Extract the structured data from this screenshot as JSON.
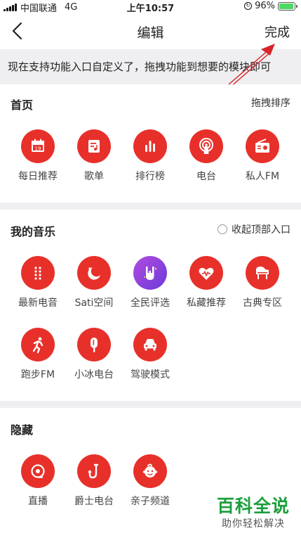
{
  "status_bar": {
    "carrier": "中国联通",
    "network": "4G",
    "time": "上午10:57",
    "battery": "96%",
    "battery_level": 0.96
  },
  "nav": {
    "title": "编辑",
    "done_label": "完成"
  },
  "tip": "现在支持功能入口自定义了，拖拽功能到想要的模块即可",
  "home": {
    "title": "首页",
    "action": "拖拽排序",
    "items": [
      {
        "label": "每日推荐",
        "icon": "calendar-icon"
      },
      {
        "label": "歌单",
        "icon": "playlist-icon"
      },
      {
        "label": "排行榜",
        "icon": "chart-bars-icon"
      },
      {
        "label": "电台",
        "icon": "radio-broadcast-icon"
      },
      {
        "label": "私人FM",
        "icon": "radio-fm-icon"
      }
    ]
  },
  "my_music": {
    "title": "我的音乐",
    "action": "收起顶部入口",
    "items": [
      {
        "label": "最新电音",
        "icon": "dots-grid-icon"
      },
      {
        "label": "Sati空间",
        "icon": "moon-star-icon"
      },
      {
        "label": "全民评选",
        "icon": "rock-hand-icon"
      },
      {
        "label": "私藏推荐",
        "icon": "heart-wave-icon"
      },
      {
        "label": "古典专区",
        "icon": "piano-icon"
      },
      {
        "label": "跑步FM",
        "icon": "running-icon"
      },
      {
        "label": "小冰电台",
        "icon": "popsicle-icon"
      },
      {
        "label": "驾驶模式",
        "icon": "car-icon"
      }
    ]
  },
  "hidden": {
    "title": "隐藏",
    "items": [
      {
        "label": "直播",
        "icon": "live-icon"
      },
      {
        "label": "爵士电台",
        "icon": "saxophone-icon"
      },
      {
        "label": "亲子频道",
        "icon": "baby-face-icon"
      }
    ]
  },
  "watermark": {
    "main": "百科全说",
    "sub": "助你轻松解决"
  },
  "colors": {
    "accent": "#e8302a",
    "background": "#efeff1",
    "watermark_green": "#1a9f3b"
  }
}
